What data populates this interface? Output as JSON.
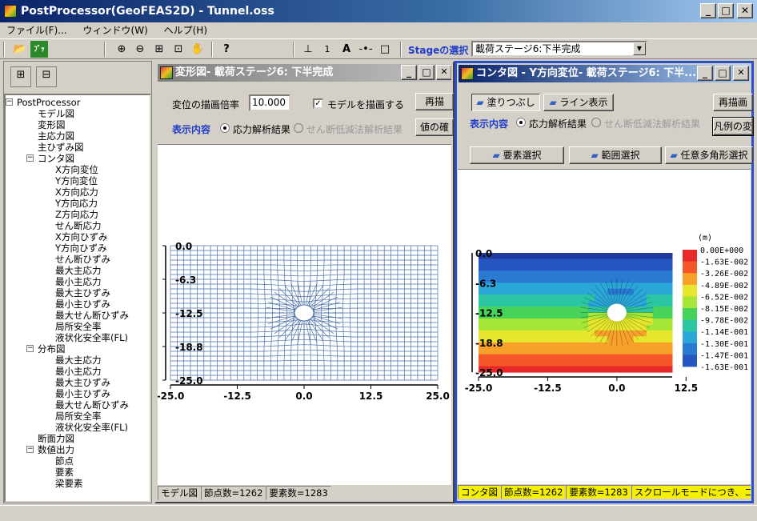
{
  "app": {
    "title": "PostProcessor(GeoFEAS2D) - Tunnel.oss"
  },
  "menu": [
    "ファイル(F)...",
    "ウィンドウ(W)",
    "ヘルプ(H)"
  ],
  "toolbar": {
    "stage_label": "Stageの選択",
    "stage_value": "載荷ステージ6:下半完成"
  },
  "tree": {
    "items": [
      {
        "label": "PostProcessor",
        "level": 0,
        "expander": "−"
      },
      {
        "label": "モデル図",
        "level": 1
      },
      {
        "label": "変形図",
        "level": 1
      },
      {
        "label": "主応力図",
        "level": 1
      },
      {
        "label": "主ひずみ図",
        "level": 1
      },
      {
        "label": "コンタ図",
        "level": 1,
        "expander": "−"
      },
      {
        "label": "X方向変位",
        "level": 2
      },
      {
        "label": "Y方向変位",
        "level": 2
      },
      {
        "label": "X方向応力",
        "level": 2
      },
      {
        "label": "Y方向応力",
        "level": 2
      },
      {
        "label": "Z方向応力",
        "level": 2
      },
      {
        "label": "せん断応力",
        "level": 2
      },
      {
        "label": "X方向ひずみ",
        "level": 2
      },
      {
        "label": "Y方向ひずみ",
        "level": 2
      },
      {
        "label": "せん断ひずみ",
        "level": 2
      },
      {
        "label": "最大主応力",
        "level": 2
      },
      {
        "label": "最小主応力",
        "level": 2
      },
      {
        "label": "最大主ひずみ",
        "level": 2
      },
      {
        "label": "最小主ひずみ",
        "level": 2
      },
      {
        "label": "最大せん断ひずみ",
        "level": 2
      },
      {
        "label": "局所安全率",
        "level": 2
      },
      {
        "label": "液状化安全率(FL)",
        "level": 2
      },
      {
        "label": "分布図",
        "level": 1,
        "expander": "−"
      },
      {
        "label": "最大主応力",
        "level": 2
      },
      {
        "label": "最小主応力",
        "level": 2
      },
      {
        "label": "最大主ひずみ",
        "level": 2
      },
      {
        "label": "最小主ひずみ",
        "level": 2
      },
      {
        "label": "最大せん断ひずみ",
        "level": 2
      },
      {
        "label": "局所安全率",
        "level": 2
      },
      {
        "label": "液状化安全率(FL)",
        "level": 2
      },
      {
        "label": "断面力図",
        "level": 1
      },
      {
        "label": "数値出力",
        "level": 1,
        "expander": "−"
      },
      {
        "label": "節点",
        "level": 2
      },
      {
        "label": "要素",
        "level": 2
      },
      {
        "label": "梁要素",
        "level": 2
      }
    ]
  },
  "deform_window": {
    "title": "変形図- 載荷ステージ6: 下半完成",
    "scale_label": "変位の描画倍率",
    "scale_value": "10.000",
    "model_checkbox": "モデルを描画する",
    "redraw": "再描",
    "display_label": "表示内容",
    "radio1": "応力解析結果",
    "radio2": "せん断低減法解析結果",
    "value_btn": "値の確",
    "y_ticks": [
      "0.0",
      "-6.3",
      "-12.5",
      "-18.8",
      "-25.0"
    ],
    "x_ticks": [
      "-25.0",
      "-12.5",
      "0.0",
      "12.5",
      "25.0"
    ],
    "status": [
      "モデル図",
      "節点数=1262",
      "要素数=1283"
    ]
  },
  "contour_window": {
    "title": "コンタ図 - Y方向変位- 載荷ステージ6: 下半...",
    "tab_fill": "塗りつぶし",
    "tab_line": "ライン表示",
    "redraw": "再描画",
    "display_label": "表示内容",
    "radio1": "応力解析結果",
    "radio2": "せん断低減法解析結果",
    "legend_btn": "凡例の変",
    "sel1": "要素選択",
    "sel2": "範囲選択",
    "sel3": "任意多角形選択",
    "y_ticks": [
      "0.0",
      "-6.3",
      "-12.5",
      "-18.8",
      "-25.0"
    ],
    "x_ticks": [
      "-25.0",
      "-12.5",
      "0.0",
      "12.5"
    ],
    "unit": "(m)",
    "legend": [
      "0.00E+000",
      "-1.63E-002",
      "-3.26E-002",
      "-4.89E-002",
      "-6.52E-002",
      "-8.15E-002",
      "-9.78E-002",
      "-1.14E-001",
      "-1.30E-001",
      "-1.47E-001",
      "-1.63E-001"
    ],
    "legend_colors": [
      "#e8292a",
      "#f5572a",
      "#f7a12b",
      "#e6e62f",
      "#a6e637",
      "#47d35a",
      "#2cc6a2",
      "#2ba6d8",
      "#2a7ad2",
      "#2656c2",
      "#213c9e"
    ],
    "status": [
      "コンタ図",
      "節点数=1262",
      "要素数=1283",
      "スクロールモードにつき、コンタ"
    ]
  }
}
